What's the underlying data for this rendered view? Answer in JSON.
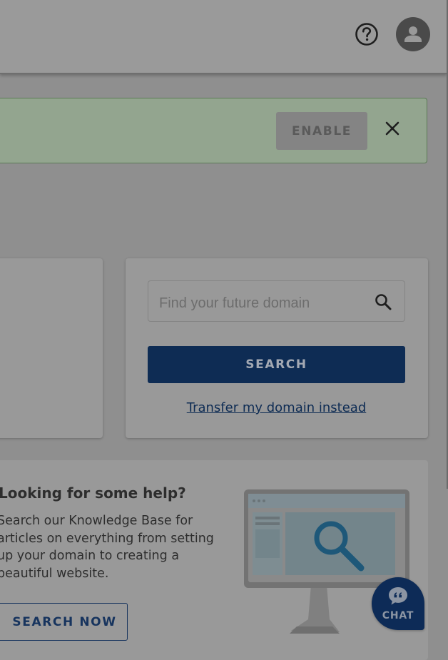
{
  "header": {
    "help_icon": "question-circle-icon",
    "avatar_icon": "user-icon"
  },
  "banner": {
    "enable_label": "ENABLE",
    "close_icon": "close-icon"
  },
  "domain_search": {
    "placeholder": "Find your future domain",
    "search_icon": "search-icon",
    "search_label": "SEARCH",
    "transfer_link": "Transfer my domain instead"
  },
  "help": {
    "title": "Looking for some help?",
    "description": "Search our Knowledge Base for articles on everything from setting up your domain to creating a beautiful website.",
    "search_now_label": "SEARCH NOW"
  },
  "chat": {
    "label": "CHAT",
    "icon": "chat-bubble-icon"
  },
  "colors": {
    "primary": "#0e2c54",
    "overlay_bg": "#8f8f8f",
    "banner_bg": "#93a58f"
  }
}
